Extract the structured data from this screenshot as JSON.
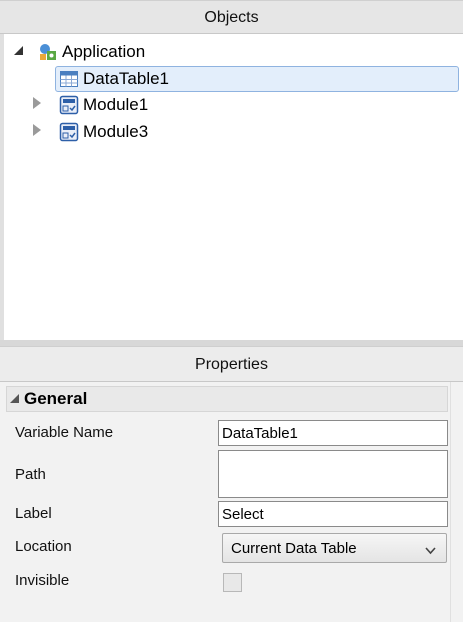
{
  "objects_panel": {
    "title": "Objects",
    "tree": [
      {
        "label": "Application",
        "icon": "application-icon",
        "expanded": true
      },
      {
        "label": "DataTable1",
        "icon": "data-table-icon",
        "selected": true
      },
      {
        "label": "Module1",
        "icon": "module-icon",
        "expanded": false
      },
      {
        "label": "Module3",
        "icon": "module-icon",
        "expanded": false
      }
    ]
  },
  "properties_panel": {
    "title": "Properties",
    "group": "General",
    "fields": {
      "variable_name": {
        "label": "Variable Name",
        "value": "DataTable1"
      },
      "path": {
        "label": "Path",
        "value": ""
      },
      "label": {
        "label": "Label",
        "value": "Select"
      },
      "location": {
        "label": "Location",
        "value": "Current Data Table"
      },
      "invisible": {
        "label": "Invisible",
        "checked": false
      }
    }
  },
  "colors": {
    "selection_bg": "#e3eefb",
    "selection_border": "#8fb3e0",
    "header_bg": "#e6e6e6"
  }
}
